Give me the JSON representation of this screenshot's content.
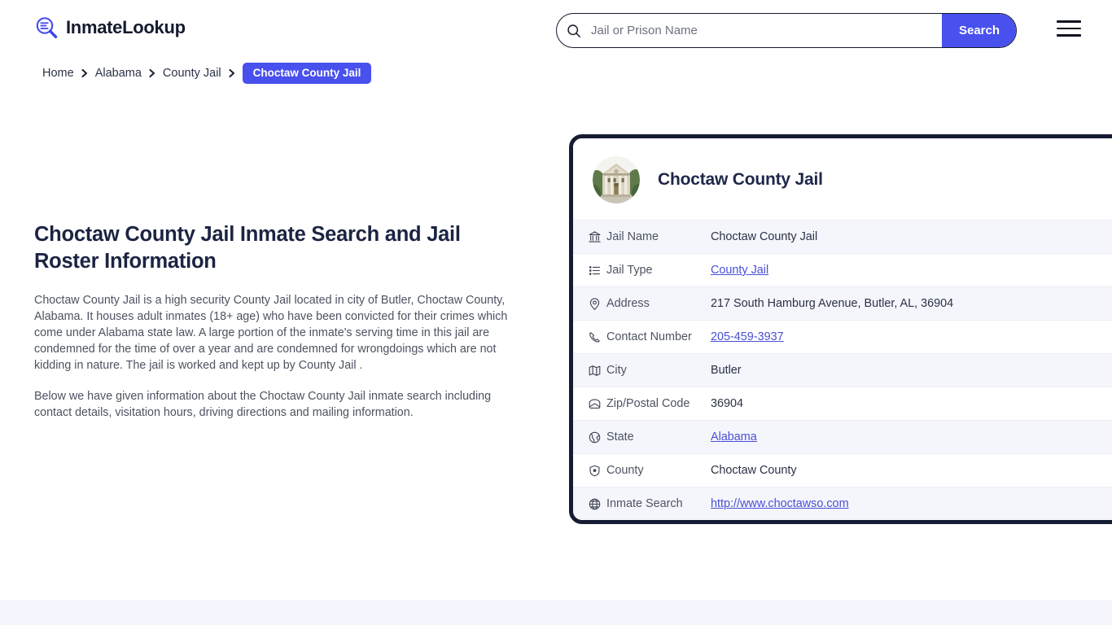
{
  "header": {
    "logo_text": "InmateLookup",
    "logo_icon": "magnifier-list-icon",
    "menu_icon": "hamburger-menu-icon"
  },
  "search": {
    "icon": "search-icon",
    "placeholder": "Jail or Prison Name",
    "value": "",
    "button_label": "Search"
  },
  "breadcrumb": {
    "items": [
      {
        "label": "Home",
        "active": false
      },
      {
        "label": "Alabama",
        "active": false
      },
      {
        "label": "County Jail",
        "active": false
      },
      {
        "label": "Choctaw County Jail",
        "active": true
      }
    ],
    "separator_icon": "chevron-right-icon"
  },
  "article": {
    "heading": "Choctaw County Jail Inmate Search and Jail Roster Information",
    "paragraph_1": "Choctaw County Jail is a high security County Jail located in city of Butler, Choctaw County, Alabama. It houses adult inmates (18+ age) who have been convicted for their crimes which come under Alabama state law. A large portion of the inmate's serving time in this jail are condemned for the time of over a year and are condemned for wrongdoings which are not kidding in nature. The jail is worked and kept up by County Jail .",
    "paragraph_2": "Below we have given information about the Choctaw County Jail inmate search including contact details, visitation hours, driving directions and mailing information."
  },
  "card": {
    "photo_icon": "courthouse-photo",
    "title": "Choctaw County Jail",
    "rows": [
      {
        "icon": "bank-building-icon",
        "label": "Jail Name",
        "value": "Choctaw County Jail",
        "link": false
      },
      {
        "icon": "list-icon",
        "label": "Jail Type",
        "value": "County Jail",
        "link": true
      },
      {
        "icon": "map-pin-icon",
        "label": "Address",
        "value": "217 South Hamburg Avenue, Butler, AL, 36904",
        "link": false
      },
      {
        "icon": "phone-icon",
        "label": "Contact Number",
        "value": "205-459-3937",
        "link": true
      },
      {
        "icon": "map-icon",
        "label": "City",
        "value": "Butler",
        "link": false
      },
      {
        "icon": "envelope-icon",
        "label": "Zip/Postal Code",
        "value": "36904",
        "link": false
      },
      {
        "icon": "globe-americas-icon",
        "label": "State",
        "value": "Alabama",
        "link": true
      },
      {
        "icon": "shield-badge-icon",
        "label": "County",
        "value": "Choctaw County",
        "link": false
      },
      {
        "icon": "globe-icon",
        "label": "Inmate Search",
        "value": "http://www.choctawso.com",
        "link": true
      }
    ]
  },
  "colors": {
    "accent": "#4850ee",
    "card_border": "#151c33",
    "link": "#4a4fd4",
    "alt_row": "#f4f6fc",
    "footer_strip": "#f5f6fd",
    "heading": "#1c2442"
  }
}
